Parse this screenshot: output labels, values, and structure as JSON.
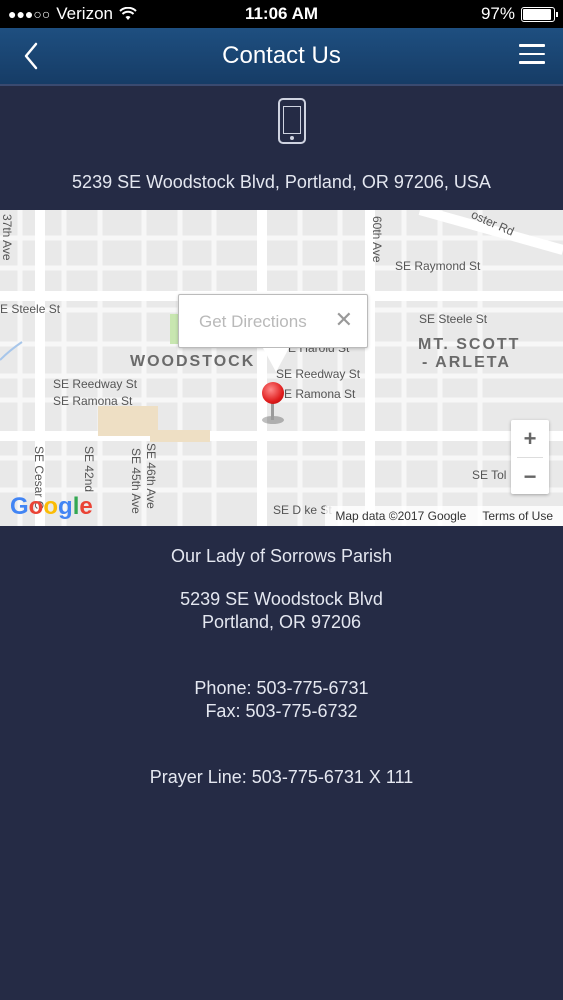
{
  "status_bar": {
    "carrier": "Verizon",
    "signal": "●●●○○",
    "time": "11:06 AM",
    "battery": "97%"
  },
  "nav": {
    "title": "Contact Us"
  },
  "header": {
    "address": "5239 SE Woodstock Blvd, Portland, OR 97206, USA"
  },
  "map": {
    "callout_text": "Get Directions",
    "close_glyph": "✕",
    "zoom_in": "+",
    "zoom_out": "−",
    "google": "Google",
    "attribution": "Map data ©2017 Google",
    "terms": "Terms of Use",
    "areas": {
      "woodstock": "WOODSTOCK",
      "mt_scott_1": "MT. SCOTT",
      "mt_scott_2": "- ARLETA"
    },
    "streets": {
      "steele_w": "E Steele St",
      "steele_e": "SE Steele St",
      "raymond": "SE Raymond St",
      "harold": "E Harold St",
      "reedway_w": "SE Reedway St",
      "ramona_w": "SE Ramona St",
      "reedway_e": "SE Reedway St",
      "ramona_e": "E Ramona St",
      "tolman": "SE Tol",
      "duke": "SE D  ke St",
      "foster": "oster Rd",
      "ave37": "37th Ave",
      "ave60": "60th Ave",
      "cesar": "SE Cesar C",
      "ave42": "SE 42nd",
      "ave45": "SE 45th Ave",
      "ave46": "SE 46th Ave"
    }
  },
  "contact": {
    "name": "Our Lady of Sorrows Parish",
    "street": "5239 SE Woodstock Blvd",
    "city": "Portland, OR 97206",
    "phone": "Phone: 503-775-6731",
    "fax": "Fax: 503-775-6732",
    "prayer": "Prayer Line: 503-775-6731 X 111"
  }
}
